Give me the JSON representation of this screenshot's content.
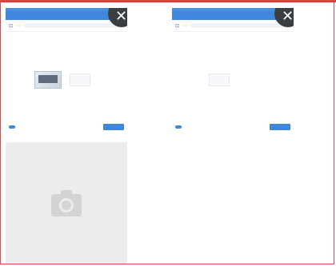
{
  "cards": [
    {
      "title": "",
      "tab": "",
      "search_placeholder": "",
      "section": "",
      "fields": [
        {
          "k": "",
          "v": ""
        },
        {
          "k": "",
          "v": ""
        },
        {
          "k": "",
          "v": ""
        },
        {
          "k": "",
          "v": ""
        },
        {
          "k": "",
          "v": ""
        }
      ],
      "photo_label": "",
      "upload_label": "",
      "extra_fields": [
        {
          "k": "",
          "v": ""
        },
        {
          "k": "",
          "v": ""
        },
        {
          "k": "",
          "v": ""
        }
      ],
      "footer": {
        "toggle_label": "",
        "sig": "",
        "mid": "",
        "submit": ""
      }
    },
    {
      "title": "",
      "tab": "",
      "search_placeholder": "",
      "section": "",
      "fields": [
        {
          "k": "",
          "v": ""
        },
        {
          "k": "",
          "v": ""
        },
        {
          "k": "",
          "v": ""
        },
        {
          "k": "",
          "v": ""
        },
        {
          "k": "",
          "v": ""
        }
      ],
      "photo_label": "",
      "upload_label": "",
      "extra_fields": [
        {
          "k": "",
          "v": ""
        },
        {
          "k": "",
          "v": ""
        },
        {
          "k": "",
          "v": ""
        }
      ],
      "footer": {
        "toggle_label": "",
        "sig": "",
        "mid": "",
        "submit": ""
      }
    }
  ],
  "close_icon_glyph": "✕",
  "colors": {
    "frame": "#e23b3b",
    "accent": "#3f87dc",
    "placeholder": "#ececec"
  }
}
